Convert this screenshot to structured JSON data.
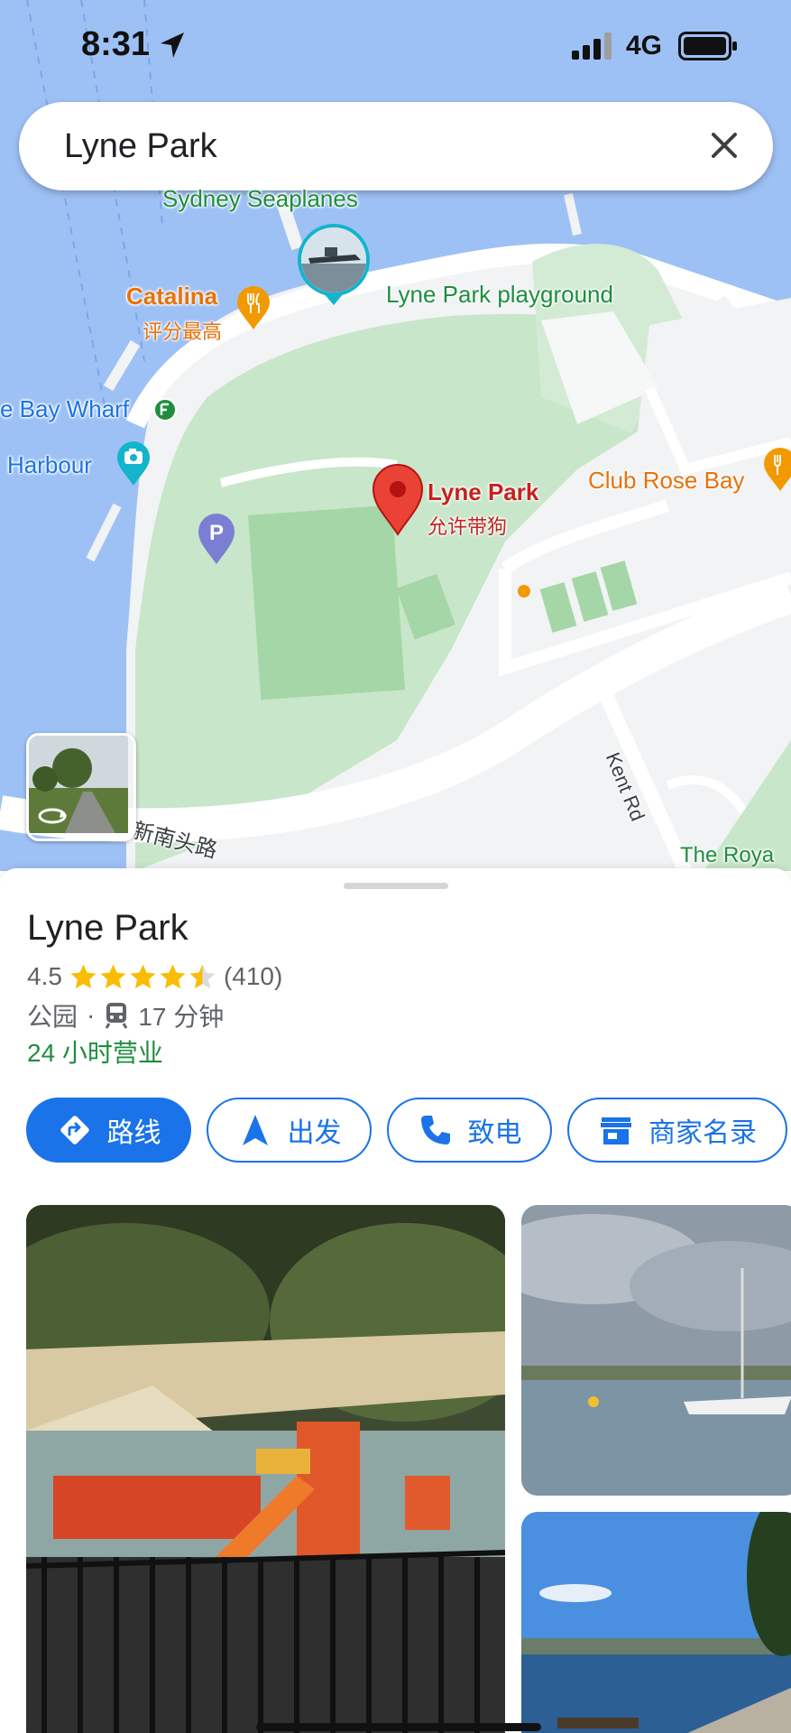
{
  "status": {
    "time": "8:31",
    "network": "4G"
  },
  "search": {
    "query": "Lyne Park"
  },
  "map": {
    "labels": {
      "seaplanes": "Sydney Seaplanes",
      "catalina": "Catalina",
      "catalina_sub": "评分最高",
      "playground": "Lyne Park playground",
      "wharf": "e Bay Wharf",
      "harbour": "Harbour",
      "club": "Club Rose Bay",
      "pin_name": "Lyne Park",
      "pin_sub": "允许带狗",
      "street1": "新南头路",
      "street2": "Kent Rd",
      "royal": "The Roya"
    },
    "icons": {
      "restaurant": "fork-knife-icon",
      "ferry": "ferry-icon",
      "camera": "camera-icon",
      "parking": "parking-icon",
      "pin": "location-pin-icon",
      "streetview": "street-view-rotate-icon"
    },
    "colors": {
      "water": "#9ec1f5",
      "park": "#c8e6c9",
      "land": "#f1f3f4",
      "pin": "#ea4335"
    }
  },
  "place": {
    "name": "Lyne Park",
    "rating": "4.5",
    "rating_value": 4.5,
    "reviews": "(410)",
    "category": "公园",
    "separator": "·",
    "transit_time": "17 分钟",
    "hours": "24 小时营业"
  },
  "actions": [
    {
      "label": "路线",
      "icon": "directions-icon",
      "primary": true
    },
    {
      "label": "出发",
      "icon": "navigation-arrow-icon",
      "primary": false
    },
    {
      "label": "致电",
      "icon": "phone-icon",
      "primary": false
    },
    {
      "label": "商家名录",
      "icon": "storefront-icon",
      "primary": false
    }
  ],
  "photos": [
    {
      "name": "playground-photo"
    },
    {
      "name": "harbour-boats-photo"
    },
    {
      "name": "waterfront-photo"
    }
  ],
  "colors": {
    "accent": "#1a73e8",
    "open": "#1e8e3e",
    "star": "#fbbc04"
  }
}
